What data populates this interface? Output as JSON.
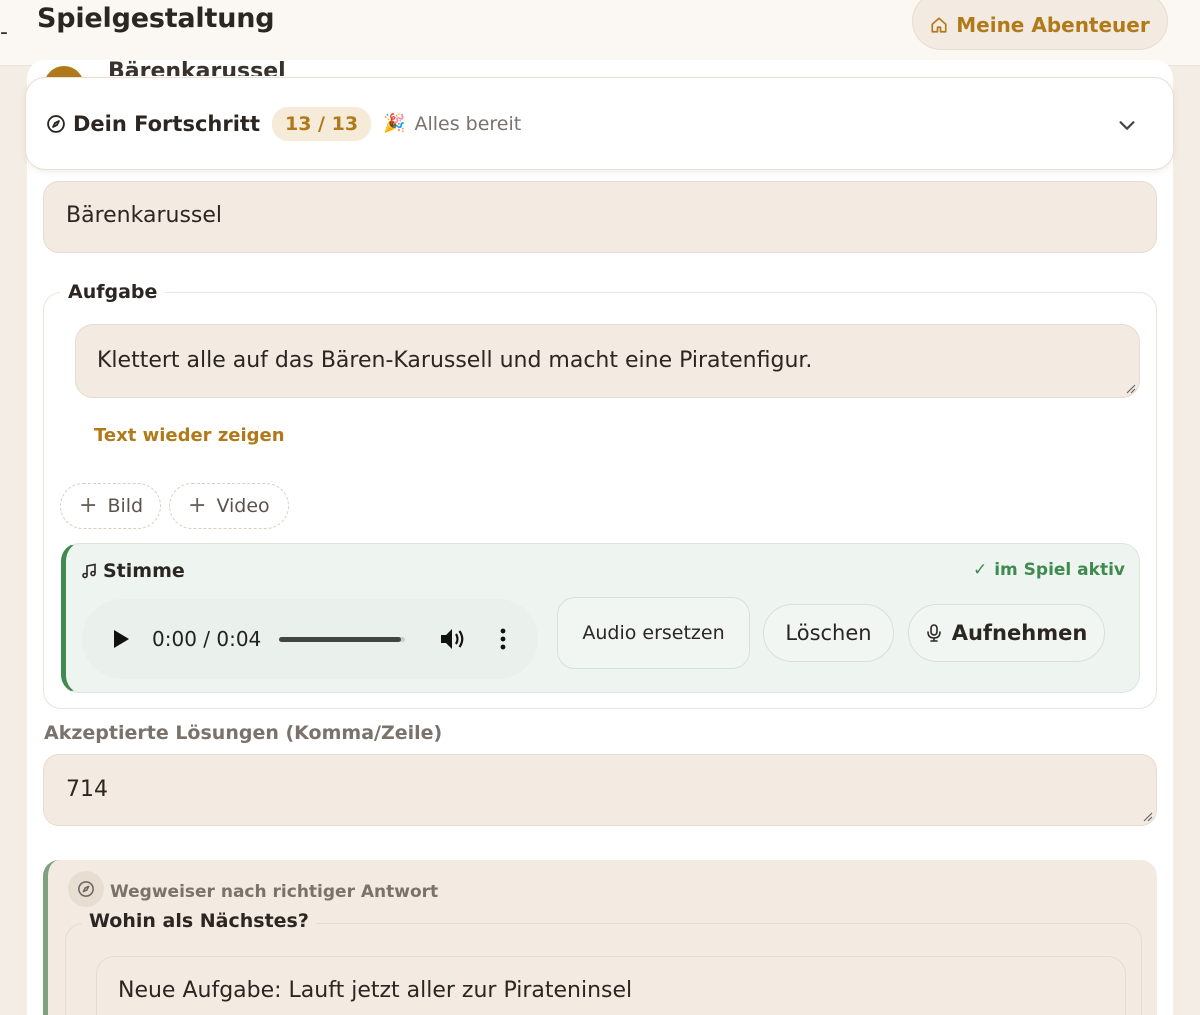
{
  "header": {
    "title": "Spielgestaltung",
    "home_button": "Meine Abenteuer"
  },
  "behind_title": "Bärenkarussel",
  "progress": {
    "title": "Dein Fortschritt",
    "count": "13 / 13",
    "status_emoji": "🎉",
    "status": "Alles bereit"
  },
  "station_name": "Bärenkarussel",
  "task": {
    "legend": "Aufgabe",
    "text": "Klettert alle auf das Bären-Karussell und macht eine Piratenfigur.",
    "show_text_link": "Text wieder zeigen",
    "add_image": "Bild",
    "add_video": "Video"
  },
  "voice": {
    "title": "Stimme",
    "active_label": "im Spiel aktiv",
    "player_time": "0:00 / 0:04",
    "replace_button": "Audio ersetzen",
    "delete_button": "Löschen",
    "record_button": "Aufnehmen",
    "accent_color": "#3f8a4f"
  },
  "solutions": {
    "label": "Akzeptierte Lösungen (Komma/Zeile)",
    "value": "714"
  },
  "guide": {
    "label": "Wegweiser nach richtiger Antwort",
    "legend": "Wohin als Nächstes?",
    "value": "Neue Aufgabe: Lauft jetzt aller zur Pirateninsel"
  },
  "colors": {
    "accent": "#b07a1b",
    "success": "#3f8a4f",
    "background": "#f4ede6"
  }
}
